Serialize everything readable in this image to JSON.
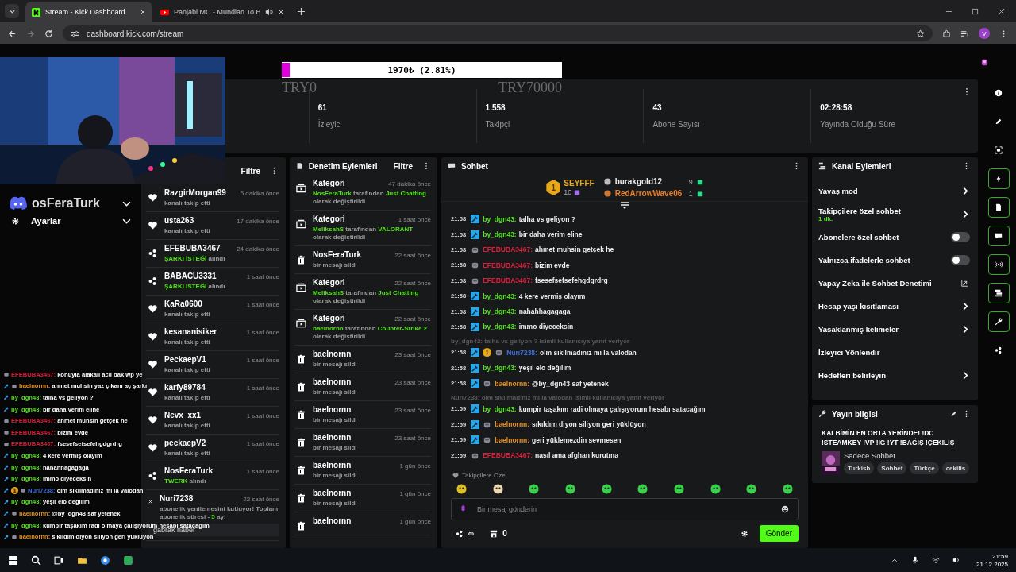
{
  "browser": {
    "tabs": [
      {
        "title": "Stream - Kick Dashboard",
        "selected": true,
        "kind": "kick",
        "audio": false
      },
      {
        "title": "Panjabi MC - Mundian To B",
        "selected": false,
        "kind": "youtube",
        "audio": true
      }
    ],
    "address": "dashboard.kick.com/stream",
    "profile": "V"
  },
  "goal": {
    "label": "1970₺ (2.81%)",
    "level": 0.0281,
    "min": "TRY0",
    "max": "TRY70000"
  },
  "stats": [
    {
      "value": "61",
      "label": "İzleyici"
    },
    {
      "value": "1.558",
      "label": "Takipçi"
    },
    {
      "value": "43",
      "label": "Abone Sayısı"
    },
    {
      "value": "02:28:58",
      "label": "Yayında Olduğu Süre"
    }
  ],
  "activity": {
    "filter": "Filtre",
    "items": [
      {
        "kind": "follow",
        "user": "RazgirMorgan99",
        "time": "5 dakika önce",
        "detail": "kanalı takip etti"
      },
      {
        "kind": "follow",
        "user": "usta263",
        "time": "17 dakika önce",
        "detail": "kanalı takip etti"
      },
      {
        "kind": "song",
        "user": "EFEBUBA3467",
        "time": "24 dakika önce",
        "detail": "**ŞARKI İSTEĞİ** alındı"
      },
      {
        "kind": "song",
        "user": "BABACU3331",
        "time": "1 saat önce",
        "detail": "**ŞARKI İSTEĞİ** alındı"
      },
      {
        "kind": "follow",
        "user": "KaRa0600",
        "time": "1 saat önce",
        "detail": "kanalı takip etti"
      },
      {
        "kind": "follow",
        "user": "kesananisiker",
        "time": "1 saat önce",
        "detail": "kanalı takip etti"
      },
      {
        "kind": "follow",
        "user": "PeckaepV1",
        "time": "1 saat önce",
        "detail": "kanalı takip etti"
      },
      {
        "kind": "follow",
        "user": "karfy89784",
        "time": "1 saat önce",
        "detail": "kanalı takip etti"
      },
      {
        "kind": "follow",
        "user": "Nevx_xx1",
        "time": "1 saat önce",
        "detail": "kanalı takip etti"
      },
      {
        "kind": "follow",
        "user": "peckaepV2",
        "time": "1 saat önce",
        "detail": "kanalı takip etti"
      },
      {
        "kind": "song",
        "user": "NosFeraTurk",
        "time": "1 saat önce",
        "detail": "**TWERK** alındı"
      },
      {
        "kind": "sub",
        "user": "Nuri7238",
        "time": "22 saat önce",
        "detail": "abonelik yenilemesini kutluyor! Toplam abonelik süresi - **5** ay!",
        "message": "gabrak naber"
      }
    ]
  },
  "moderation": {
    "title": "Denetim Eylemleri",
    "filter": "Filtre",
    "items": [
      {
        "kind": "category",
        "title": "Kategori",
        "time": "47 dakika önce",
        "detail": "**NosFeraTurk** tarafından **Just Chatting** olarak değiştirildi"
      },
      {
        "kind": "category",
        "title": "Kategori",
        "time": "1 saat önce",
        "detail": "**MeliksahS** tarafından **VALORANT** olarak değiştirildi"
      },
      {
        "kind": "delete",
        "title": "NosFeraTurk",
        "time": "22 saat önce",
        "detail": "bir mesajı sildi"
      },
      {
        "kind": "category",
        "title": "Kategori",
        "time": "22 saat önce",
        "detail": "**MeliksahS** tarafından **Just Chatting** olarak değiştirildi"
      },
      {
        "kind": "category",
        "title": "Kategori",
        "time": "22 saat önce",
        "detail": "**baelnornn** tarafından **Counter-Strike 2** olarak değiştirildi"
      },
      {
        "kind": "delete",
        "title": "baelnornn",
        "time": "23 saat önce",
        "detail": "bir mesajı sildi"
      },
      {
        "kind": "delete",
        "title": "baelnornn",
        "time": "23 saat önce",
        "detail": "bir mesajı sildi"
      },
      {
        "kind": "delete",
        "title": "baelnornn",
        "time": "23 saat önce",
        "detail": "bir mesajı sildi"
      },
      {
        "kind": "delete",
        "title": "baelnornn",
        "time": "23 saat önce",
        "detail": "bir mesajı sildi"
      },
      {
        "kind": "delete",
        "title": "baelnornn",
        "time": "1 gün önce",
        "detail": "bir mesajı sildi"
      },
      {
        "kind": "delete",
        "title": "baelnornn",
        "time": "1 gün önce",
        "detail": "bir mesajı sildi"
      },
      {
        "kind": "delete",
        "title": "baelnornn",
        "time": "1 gün önce"
      }
    ]
  },
  "chat": {
    "title": "Sohbet",
    "leaders": [
      {
        "rank": "1",
        "name": "SEYFFF",
        "count": "10"
      },
      {
        "name": "burakgold12",
        "count": "9"
      },
      {
        "name": "RedArrowWave06",
        "count": "1"
      }
    ],
    "messages": [
      {
        "time": "21:58",
        "badges": [
          {
            "kind": "mod"
          }
        ],
        "user": "by_dgn43:",
        "color": "#53e01c",
        "text": "talha vs geliyon ?"
      },
      {
        "time": "21:58",
        "badges": [
          {
            "kind": "mod"
          }
        ],
        "user": "by_dgn43:",
        "color": "#53e01c",
        "text": "bir daha verim eline"
      },
      {
        "time": "21:58",
        "badges": [
          {
            "kind": "sub"
          }
        ],
        "user": "EFEBUBA3467:",
        "color": "#d8203c",
        "text": "ahmet muhsin getçek he"
      },
      {
        "time": "21:58",
        "badges": [
          {
            "kind": "sub"
          }
        ],
        "user": "EFEBUBA3467:",
        "color": "#d8203c",
        "text": "bizim evde"
      },
      {
        "time": "21:58",
        "badges": [
          {
            "kind": "sub"
          }
        ],
        "user": "EFEBUBA3467:",
        "color": "#d8203c",
        "text": "fsesefsefsefehgdgrdrg"
      },
      {
        "time": "21:58",
        "badges": [
          {
            "kind": "mod"
          }
        ],
        "user": "by_dgn43:",
        "color": "#53e01c",
        "text": "4 kere vermiş olayım"
      },
      {
        "time": "21:58",
        "badges": [
          {
            "kind": "mod"
          }
        ],
        "user": "by_dgn43:",
        "color": "#53e01c",
        "text": "nahahhagagaga"
      },
      {
        "time": "21:58",
        "badges": [
          {
            "kind": "mod"
          }
        ],
        "user": "by_dgn43:",
        "color": "#53e01c",
        "text": "immo diyeceksin"
      },
      {
        "reply": "by_dgn43: talha vs geliyon ? isimli kullanıcıya yanıt veriyor",
        "time": "21:58",
        "badges": [
          {
            "kind": "mod"
          },
          {
            "kind": "gift",
            "text": "1"
          },
          {
            "kind": "sub"
          }
        ],
        "user": "Nuri7238:",
        "color": "#3b6fe0",
        "text": "olm sıkılmadınız mı la valodan"
      },
      {
        "time": "21:58",
        "badges": [
          {
            "kind": "mod"
          }
        ],
        "user": "by_dgn43:",
        "color": "#53e01c",
        "text": "yeşil elo değilim"
      },
      {
        "time": "21:58",
        "badges": [
          {
            "kind": "mod"
          },
          {
            "kind": "sub"
          }
        ],
        "user": "baelnornn:",
        "color": "#e8901c",
        "text": "@by_dgn43 saf yetenek"
      },
      {
        "reply": "Nuri7238: olm sıkılmadınız mı la valodan isimli kullanıcıya yanıt veriyor",
        "time": "21:59",
        "badges": [
          {
            "kind": "mod"
          }
        ],
        "user": "by_dgn43:",
        "color": "#53e01c",
        "text": "kumpir taşakım radi olmaya çalışıyorum hesabı satacağım"
      },
      {
        "time": "21:59",
        "badges": [
          {
            "kind": "mod"
          },
          {
            "kind": "sub"
          }
        ],
        "user": "baelnornn:",
        "color": "#e8901c",
        "text": "sıkıldım diyon siliyon geri yüklüyon"
      },
      {
        "time": "21:59",
        "badges": [
          {
            "kind": "mod"
          },
          {
            "kind": "sub"
          }
        ],
        "user": "baelnornn:",
        "color": "#e8901c",
        "text": "geri yüklemezdin sevmesen"
      },
      {
        "time": "21:59",
        "badges": [
          {
            "kind": "sub"
          }
        ],
        "user": "EFEBUBA3467:",
        "color": "#d8203c",
        "text": "nasıl ama afghan kurutma"
      }
    ],
    "emote_label": "Takipçilere Özel",
    "placeholder": "Bir mesaj gönderin",
    "points": "∞",
    "count": "0",
    "send": "Gönder"
  },
  "channel_actions": {
    "title": "Kanal Eylemleri",
    "items": [
      {
        "kind": "chevron",
        "label": "Yavaş mod"
      },
      {
        "kind": "chevron",
        "label": "Takipçilere özel sohbet",
        "sub": "1 dk."
      },
      {
        "kind": "toggle",
        "label": "Abonelere özel sohbet",
        "on": false
      },
      {
        "kind": "toggle",
        "label": "Yalnızca ifadelerle sohbet",
        "on": false
      },
      {
        "kind": "external",
        "label": "Yapay Zeka ile Sohbet Denetimi"
      },
      {
        "kind": "chevron",
        "label": "Hesap yaşı kısıtlaması"
      },
      {
        "kind": "chevron",
        "label": "Yasaklanmış kelimeler"
      },
      {
        "kind": "plain",
        "label": "İzleyici Yönlendir"
      },
      {
        "kind": "chevron",
        "label": "Hedefleri belirleyin"
      }
    ]
  },
  "stream_info": {
    "title": "Yayın bilgisi",
    "stream_title": "KALBİMİN EN ORTA YERİNDE! !DC !STEAMKEY !VP !İG !YT !BAĞIŞ !ÇEKİLİŞ",
    "category": "Sadece Sohbet",
    "tags": [
      "Turkish",
      "Sohbet",
      "Türkçe",
      "cekilis"
    ]
  },
  "rail": [
    {
      "kind": "info",
      "highlighted": false
    },
    {
      "kind": "pencil",
      "highlighted": false
    },
    {
      "kind": "focus",
      "highlighted": false
    },
    {
      "kind": "bolt",
      "highlighted": true
    },
    {
      "kind": "notes",
      "highlighted": true
    },
    {
      "kind": "chat",
      "highlighted": true
    },
    {
      "kind": "broadcast",
      "highlighted": true
    },
    {
      "kind": "media",
      "highlighted": true
    },
    {
      "kind": "wrench",
      "highlighted": true
    },
    {
      "kind": "nodes",
      "highlighted": false
    }
  ],
  "overlay": {
    "discord_name": "osFeraTurk",
    "settings": "Ayarlar",
    "chat": [
      {
        "badges": [
          {
            "kind": "sub"
          }
        ],
        "user": "EFEBUBA3467:",
        "color": "#d8203c",
        "text": "konuyla alakalı acil bak wp ye"
      },
      {
        "badges": [
          {
            "kind": "mod"
          },
          {
            "kind": "sub"
          }
        ],
        "user": "baelnornn:",
        "color": "#e8901c",
        "text": "ahmet muhsin yaz çıkanı aç şarkı"
      },
      {
        "badges": [
          {
            "kind": "mod"
          }
        ],
        "user": "by_dgn43:",
        "color": "#53e01c",
        "text": "talha vs geliyon ?"
      },
      {
        "badges": [
          {
            "kind": "mod"
          }
        ],
        "user": "by_dgn43:",
        "color": "#53e01c",
        "text": "bir daha verim eline"
      },
      {
        "badges": [
          {
            "kind": "sub"
          }
        ],
        "user": "EFEBUBA3467:",
        "color": "#d8203c",
        "text": "ahmet muhsin getçek he"
      },
      {
        "badges": [
          {
            "kind": "sub"
          }
        ],
        "user": "EFEBUBA3467:",
        "color": "#d8203c",
        "text": "bizim evde"
      },
      {
        "badges": [
          {
            "kind": "sub"
          }
        ],
        "user": "EFEBUBA3467:",
        "color": "#d8203c",
        "text": "fsesefsefsefehgdgrdrg"
      },
      {
        "badges": [
          {
            "kind": "mod"
          }
        ],
        "user": "by_dgn43:",
        "color": "#53e01c",
        "text": "4 kere vermiş olayım"
      },
      {
        "badges": [
          {
            "kind": "mod"
          }
        ],
        "user": "by_dgn43:",
        "color": "#53e01c",
        "text": "nahahhagagaga"
      },
      {
        "badges": [
          {
            "kind": "mod"
          }
        ],
        "user": "by_dgn43:",
        "color": "#53e01c",
        "text": "immo diyeceksin"
      },
      {
        "badges": [
          {
            "kind": "mod"
          },
          {
            "kind": "gift",
            "text": "1"
          },
          {
            "kind": "sub"
          }
        ],
        "user": "Nuri7238:",
        "color": "#3b6fe0",
        "text": "olm sıkılmadınız mı la valodan"
      },
      {
        "badges": [
          {
            "kind": "mod"
          }
        ],
        "user": "by_dgn43:",
        "color": "#53e01c",
        "text": "yeşil elo değilim"
      },
      {
        "badges": [
          {
            "kind": "mod"
          },
          {
            "kind": "sub"
          }
        ],
        "user": "baelnornn:",
        "color": "#e8901c",
        "text": "@by_dgn43 saf yetenek"
      },
      {
        "badges": [
          {
            "kind": "mod"
          }
        ],
        "user": "by_dgn43:",
        "color": "#53e01c",
        "text": "kumpir taşakım radi olmaya çalışıyorum hesabı satacağım"
      },
      {
        "badges": [
          {
            "kind": "mod"
          },
          {
            "kind": "sub"
          }
        ],
        "user": "baelnornn:",
        "color": "#e8901c",
        "text": "sıkıldım diyon siliyon geri yüklüyon"
      }
    ]
  },
  "taskbar": {
    "time": "21:59",
    "date": "21.12.2025"
  }
}
